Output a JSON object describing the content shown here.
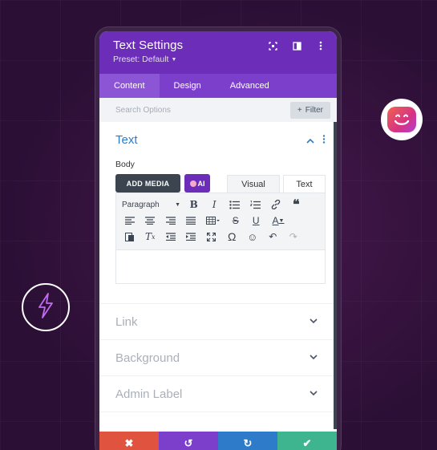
{
  "header": {
    "title": "Text Settings",
    "preset_label": "Preset: Default",
    "icons": [
      "focus-icon",
      "split-view-icon",
      "more-vertical-icon"
    ]
  },
  "tabs": [
    {
      "label": "Content",
      "active": true
    },
    {
      "label": "Design",
      "active": false
    },
    {
      "label": "Advanced",
      "active": false
    }
  ],
  "search": {
    "placeholder": "Search Options",
    "filter_label": "Filter"
  },
  "text_section": {
    "title": "Text",
    "body_label": "Body",
    "add_media_label": "ADD MEDIA",
    "ai_label": "AI",
    "editor_tabs": [
      "Visual",
      "Text"
    ],
    "format_select": "Paragraph"
  },
  "collapsed_sections": [
    {
      "label": "Link"
    },
    {
      "label": "Background"
    },
    {
      "label": "Admin Label"
    }
  ],
  "footer": {
    "colors": {
      "cancel": "#e0533f",
      "undo": "#7b3fcc",
      "redo": "#2e7bc9",
      "save": "#3fb58f"
    }
  },
  "colors": {
    "accent": "#6c2eb9",
    "link_blue": "#2e7bc9"
  }
}
